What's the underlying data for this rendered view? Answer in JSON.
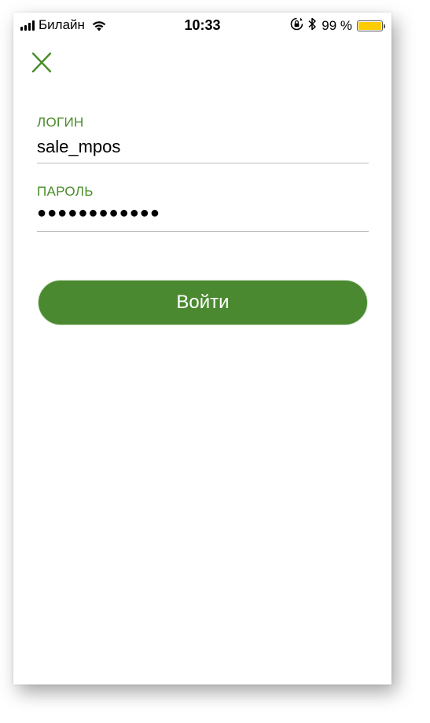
{
  "status_bar": {
    "carrier": "Билайн",
    "time": "10:33",
    "battery_percent": "99 %",
    "battery_level": 0.99,
    "icons": [
      "signal-icon",
      "wifi-icon",
      "rotation-lock-icon",
      "bluetooth-icon",
      "battery-icon"
    ]
  },
  "header": {
    "close_icon": "close-icon"
  },
  "form": {
    "login_label": "ЛОГИН",
    "login_value": "sale_mpos",
    "password_label": "ПАРОЛЬ",
    "password_value": "●●●●●●●●●●●●"
  },
  "actions": {
    "login_button": "Войти"
  },
  "colors": {
    "accent": "#4a8c2a",
    "button": "#4a8930",
    "battery": "#ffcc00"
  }
}
